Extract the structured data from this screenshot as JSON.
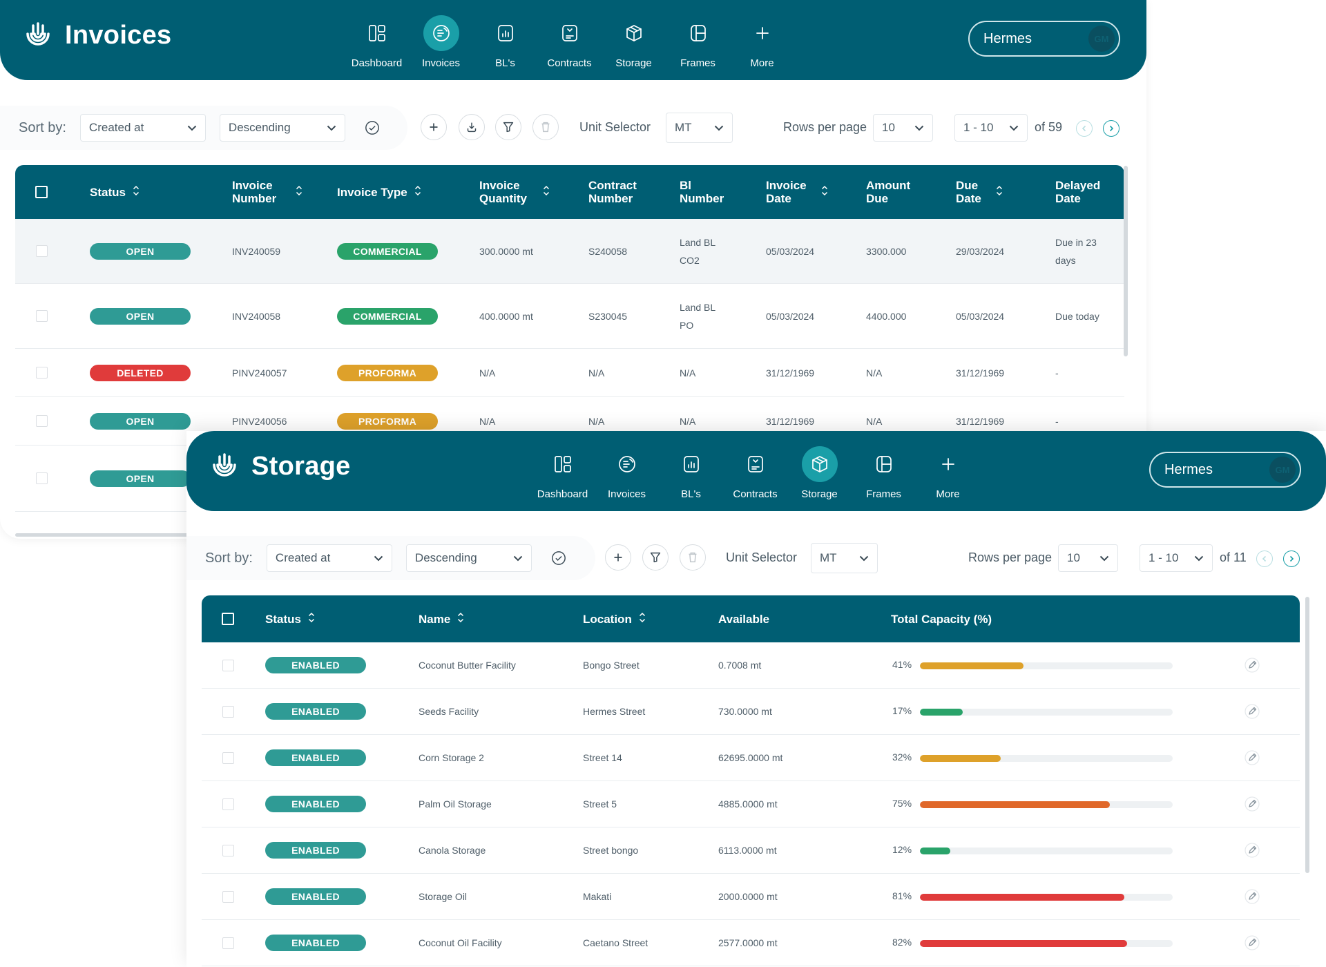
{
  "colors": {
    "primary": "#005e73",
    "accent": "#1a9fa8",
    "open": "#2f9b95",
    "deleted": "#e03b3b",
    "commercial": "#2aa36a",
    "proforma": "#dea12a",
    "bar_yellow": "#dea12a",
    "bar_green": "#2aa36a",
    "bar_orange": "#e0682a",
    "bar_red": "#e03b3b"
  },
  "nav": [
    {
      "label": "Dashboard",
      "icon": "dashboard-icon"
    },
    {
      "label": "Invoices",
      "icon": "invoice-icon"
    },
    {
      "label": "BL's",
      "icon": "bl-icon"
    },
    {
      "label": "Contracts",
      "icon": "contract-icon"
    },
    {
      "label": "Storage",
      "icon": "storage-icon"
    },
    {
      "label": "Frames",
      "icon": "frames-icon"
    },
    {
      "label": "More",
      "icon": "plus-icon"
    }
  ],
  "user": {
    "name": "Hermes",
    "initials": "GM"
  },
  "invoices": {
    "title": "Invoices",
    "toolbar": {
      "sort_label": "Sort by:",
      "sort_field": "Created at",
      "sort_order": "Descending",
      "unit_label": "Unit Selector",
      "unit": "MT",
      "rows_label": "Rows per page",
      "rows": "10",
      "range": "1 - 10",
      "total": "of 59"
    },
    "columns": [
      "Status",
      "Invoice Number",
      "Invoice Type",
      "Invoice Quantity",
      "Contract Number",
      "Bl Number",
      "Invoice Date",
      "Amount Due",
      "Due Date",
      "Delayed Date"
    ],
    "rows": [
      {
        "status": "OPEN",
        "number": "INV240059",
        "type": "COMMERCIAL",
        "qty": "300.0000 mt",
        "contract": "S240058",
        "bl": "Land BL CO2",
        "date": "05/03/2024",
        "amount": "3300.000",
        "due": "29/03/2024",
        "delayed": "Due in 23 days"
      },
      {
        "status": "OPEN",
        "number": "INV240058",
        "type": "COMMERCIAL",
        "qty": "400.0000 mt",
        "contract": "S230045",
        "bl": "Land BL PO",
        "date": "05/03/2024",
        "amount": "4400.000",
        "due": "05/03/2024",
        "delayed": "Due today"
      },
      {
        "status": "DELETED",
        "number": "PINV240057",
        "type": "PROFORMA",
        "qty": "N/A",
        "contract": "N/A",
        "bl": "N/A",
        "date": "31/12/1969",
        "amount": "N/A",
        "due": "31/12/1969",
        "delayed": "-"
      },
      {
        "status": "OPEN",
        "number": "PINV240056",
        "type": "PROFORMA",
        "qty": "N/A",
        "contract": "N/A",
        "bl": "N/A",
        "date": "31/12/1969",
        "amount": "N/A",
        "due": "31/12/1969",
        "delayed": "-"
      },
      {
        "status": "OPEN"
      }
    ]
  },
  "storage": {
    "title": "Storage",
    "toolbar": {
      "sort_label": "Sort by:",
      "sort_field": "Created at",
      "sort_order": "Descending",
      "unit_label": "Unit Selector",
      "unit": "MT",
      "rows_label": "Rows per page",
      "rows": "10",
      "range": "1 - 10",
      "total": "of 11"
    },
    "columns": [
      "Status",
      "Name",
      "Location",
      "Available",
      "Total Capacity (%)"
    ],
    "rows": [
      {
        "status": "ENABLED",
        "name": "Coconut Butter Facility",
        "location": "Bongo Street",
        "available": "0.7008 mt",
        "capacity": 41,
        "capacity_label": "41%",
        "bar": "bar_yellow"
      },
      {
        "status": "ENABLED",
        "name": "Seeds Facility",
        "location": "Hermes Street",
        "available": "730.0000 mt",
        "capacity": 17,
        "capacity_label": "17%",
        "bar": "bar_green"
      },
      {
        "status": "ENABLED",
        "name": "Corn Storage 2",
        "location": "Street 14",
        "available": "62695.0000 mt",
        "capacity": 32,
        "capacity_label": "32%",
        "bar": "bar_yellow"
      },
      {
        "status": "ENABLED",
        "name": "Palm Oil Storage",
        "location": "Street 5",
        "available": "4885.0000 mt",
        "capacity": 75,
        "capacity_label": "75%",
        "bar": "bar_orange"
      },
      {
        "status": "ENABLED",
        "name": "Canola Storage",
        "location": "Street bongo",
        "available": "6113.0000 mt",
        "capacity": 12,
        "capacity_label": "12%",
        "bar": "bar_green"
      },
      {
        "status": "ENABLED",
        "name": "Storage Oil",
        "location": "Makati",
        "available": "2000.0000 mt",
        "capacity": 81,
        "capacity_label": "81%",
        "bar": "bar_red"
      },
      {
        "status": "ENABLED",
        "name": "Coconut Oil Facility",
        "location": "Caetano Street",
        "available": "2577.0000 mt",
        "capacity": 82,
        "capacity_label": "82%",
        "bar": "bar_red"
      }
    ]
  }
}
